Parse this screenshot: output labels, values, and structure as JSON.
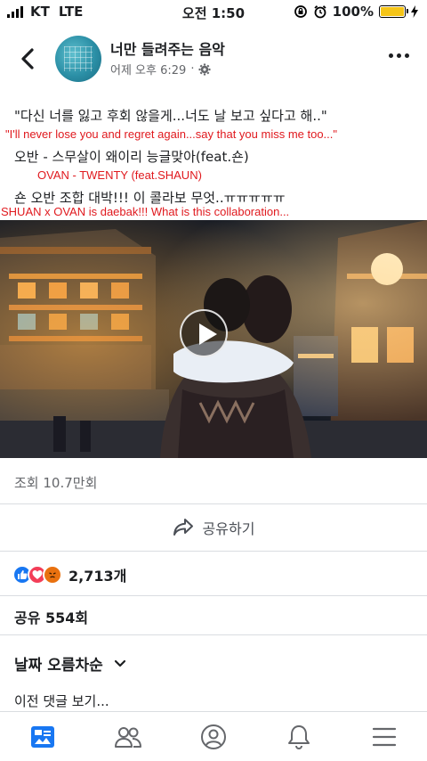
{
  "status_bar": {
    "carrier": "KT",
    "network": "LTE",
    "time": "오전 1:50",
    "battery_percent": "100%",
    "battery_level": 1.0
  },
  "header": {
    "page_name": "너만 들려주는 음악",
    "post_time": "어제 오후 6:29",
    "separator": "·",
    "privacy_icon": "gear-icon"
  },
  "caption": {
    "line1_ko": "\"다신 너를 잃고 후회 않을게...너도 날 보고 싶다고 해..\"",
    "line1_en": "\"I'll never lose you and regret again...say that you miss me too...\"",
    "line2_ko": "오반 - 스무살이 왜이리 능글맞아(feat.숀)",
    "line2_en": "OVAN - TWENTY (feat.SHAUN)",
    "line3_ko": "숀 오반 조합 대박!!! 이 콜라보 무엇..ㅠㅠㅠㅠㅠ",
    "line3_en": "SHUAN x OVAN is daebak!!! What is this collaboration..."
  },
  "video": {
    "play_icon": "play-icon"
  },
  "stats": {
    "views": "조회 10.7만회",
    "share_label": "공유하기",
    "reaction_count": "2,713개",
    "shares": "공유 554회",
    "sort_label": "날짜 오름차순",
    "prev_comments": "이전 댓글 보기..."
  },
  "tabbar": {
    "items": [
      "news-feed",
      "friends",
      "profile",
      "notifications",
      "menu"
    ]
  },
  "colors": {
    "accent_red": "#e0191e",
    "facebook_blue": "#1877f2",
    "battery": "#f5c518"
  }
}
